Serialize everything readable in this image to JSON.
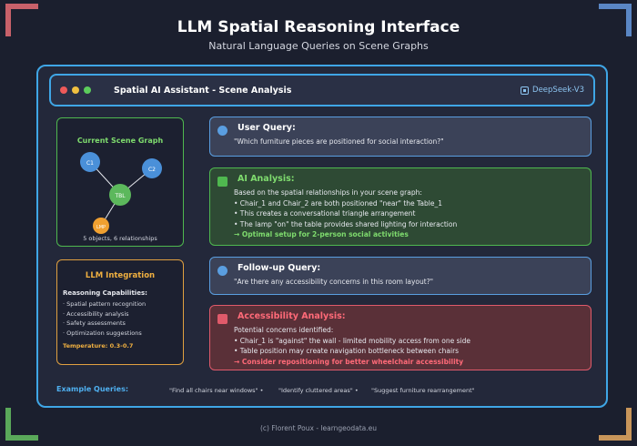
{
  "page": {
    "title": "LLM Spatial Reasoning Interface",
    "subtitle": "Natural Language Queries on Scene Graphs",
    "footer": "(c) Florent Poux - learngeodata.eu"
  },
  "header": {
    "title": "Spatial AI Assistant - Scene Analysis",
    "model": "DeepSeek-V3"
  },
  "scene_graph": {
    "title": "Current Scene Graph",
    "nodes": [
      {
        "label": "C1",
        "color": "#4a90d9"
      },
      {
        "label": "C2",
        "color": "#4a90d9"
      },
      {
        "label": "TBL",
        "color": "#5cb85c"
      },
      {
        "label": "LMP",
        "color": "#f0a030"
      }
    ],
    "caption": "5 objects, 6 relationships"
  },
  "llm_integration": {
    "title": "LLM Integration",
    "subtitle": "Reasoning Capabilities:",
    "items": [
      "· Spatial pattern recognition",
      "· Accessibility analysis",
      "· Safety assessments",
      "· Optimization suggestions"
    ],
    "temperature": "Temperature: 0.3-0.7"
  },
  "user_query": {
    "head": "User Query:",
    "text": "\"Which furniture pieces are positioned for social interaction?\""
  },
  "ai_analysis": {
    "head": "AI Analysis:",
    "lead": "Based on the spatial relationships in your scene graph:",
    "points": [
      "• Chair_1 and Chair_2 are both positioned \"near\" the Table_1",
      "• This creates a conversational triangle arrangement",
      "• The lamp \"on\" the table provides shared lighting for interaction"
    ],
    "conclusion": "→ Optimal setup for 2-person social activities"
  },
  "followup_query": {
    "head": "Follow-up Query:",
    "text": "\"Are there any accessibility concerns in this room layout?\""
  },
  "accessibility": {
    "head": "Accessibility Analysis:",
    "lead": "Potential concerns identified:",
    "points": [
      "• Chair_1 is \"against\" the wall - limited mobility access from one side",
      "• Table position may create navigation bottleneck between chairs"
    ],
    "conclusion": "→ Consider repositioning for better wheelchair accessibility"
  },
  "examples": {
    "label": "Example Queries:",
    "items": [
      "\"Find all chairs near windows\" •",
      "\"Identify cluttered areas\" •",
      "\"Suggest furniture rearrangement\""
    ]
  },
  "colors": {
    "accent_blue": "#3fa6e6",
    "green": "#4fb84f",
    "orange": "#e0a040",
    "red": "#e05a6a"
  }
}
